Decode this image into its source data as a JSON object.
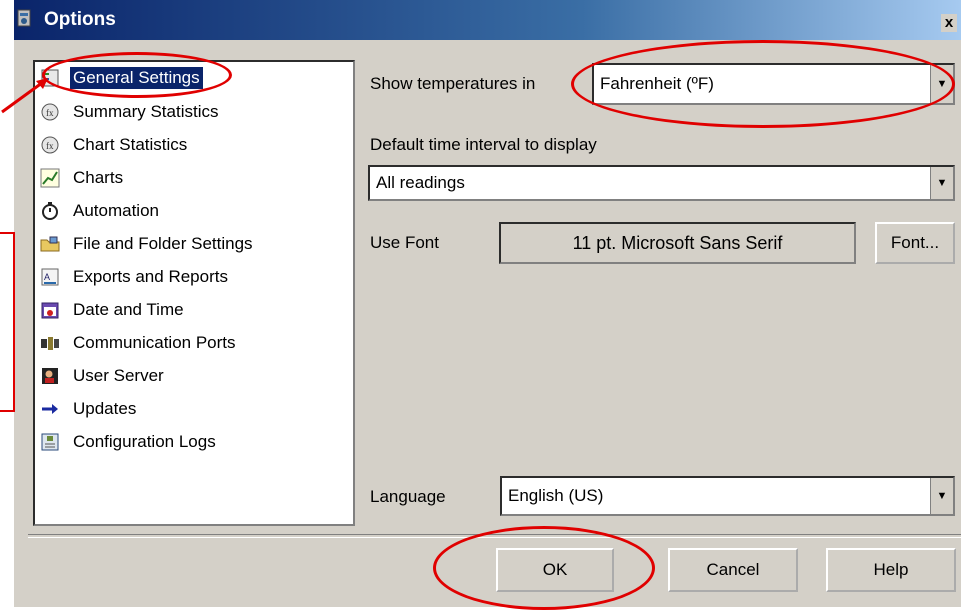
{
  "window": {
    "title": "Options",
    "close_glyph": "x"
  },
  "tree": {
    "items": [
      {
        "label": "General Settings",
        "icon": "settings-icon",
        "selected": true
      },
      {
        "label": "Summary Statistics",
        "icon": "statistics-icon"
      },
      {
        "label": "Chart Statistics",
        "icon": "chart-statistics-icon"
      },
      {
        "label": "Charts",
        "icon": "line-chart-icon"
      },
      {
        "label": "Automation",
        "icon": "clock-icon"
      },
      {
        "label": "File and Folder Settings",
        "icon": "folder-icon"
      },
      {
        "label": "Exports and Reports",
        "icon": "export-icon"
      },
      {
        "label": "Date and Time",
        "icon": "calendar-icon"
      },
      {
        "label": "Communication Ports",
        "icon": "port-icon"
      },
      {
        "label": "User Server",
        "icon": "user-server-icon"
      },
      {
        "label": "Updates",
        "icon": "arrow-right-icon"
      },
      {
        "label": "Configuration Logs",
        "icon": "log-icon"
      }
    ]
  },
  "settings": {
    "temperature_label": "Show temperatures in",
    "temperature_value": "Fahrenheit (ºF)",
    "interval_label": "Default time interval to display",
    "interval_value": "All readings",
    "font_label": "Use Font",
    "font_value": "11 pt. Microsoft Sans Serif",
    "font_button": "Font...",
    "language_label": "Language",
    "language_value": "English (US)"
  },
  "buttons": {
    "ok": "OK",
    "cancel": "Cancel",
    "help": "Help"
  },
  "colors": {
    "annotation": "#e00000",
    "selection": "#0a246a",
    "dialog_face": "#d4d0c8"
  }
}
